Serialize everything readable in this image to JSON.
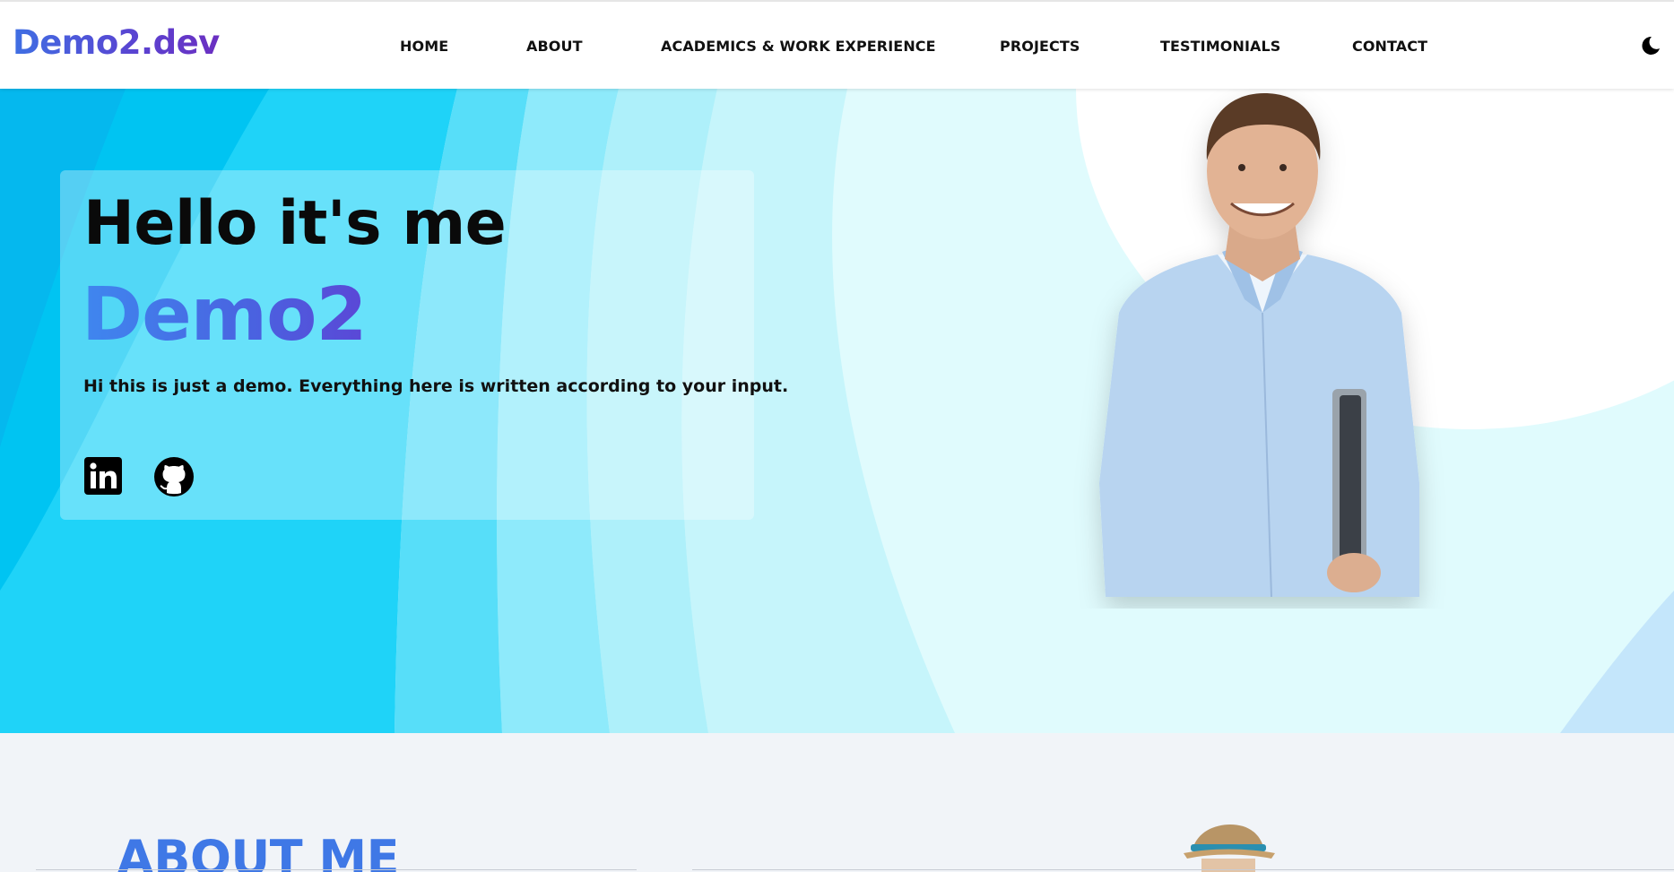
{
  "navbar": {
    "logo": "Demo2.dev",
    "links": [
      {
        "label": "HOME"
      },
      {
        "label": "ABOUT"
      },
      {
        "label": "ACADEMICS & WORK EXPERIENCE"
      },
      {
        "label": "PROJECTS"
      },
      {
        "label": "TESTIMONIALS"
      },
      {
        "label": "CONTACT"
      }
    ],
    "theme_toggle_icon": "moon-icon"
  },
  "hero": {
    "greeting": "Hello it's me",
    "name": "Demo2",
    "description": "Hi this is just a demo. Everything here is written according to your input.",
    "social": [
      {
        "icon": "linkedin-icon"
      },
      {
        "icon": "github-icon"
      }
    ]
  },
  "about": {
    "title": "ABOUT ME"
  },
  "colors": {
    "brand_gradient_start": "#3f6fe3",
    "brand_gradient_end": "#6b2fc1",
    "hero_cyan": "#00d7f8",
    "hero_light": "#e0fbfd",
    "about_bg": "#f1f4f8",
    "about_title": "#3f78e6"
  }
}
